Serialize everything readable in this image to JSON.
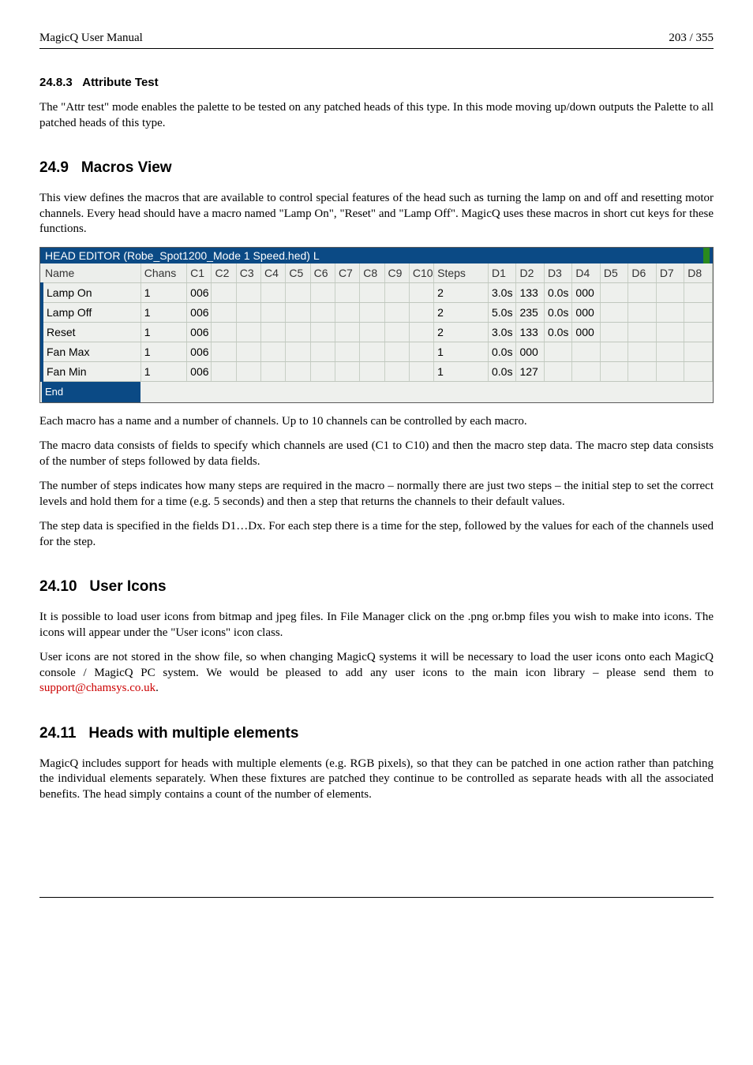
{
  "header": {
    "left": "MagicQ User Manual",
    "right": "203 / 355"
  },
  "sec1": {
    "num": "24.8.3",
    "title": "Attribute Test",
    "p1": "The \"Attr test\" mode enables the palette to be tested on any patched heads of this type. In this mode moving up/down outputs the Palette to all patched heads of this type."
  },
  "sec2": {
    "num": "24.9",
    "title": "Macros View",
    "p1": "This view defines the macros that are available to control special features of the head such as turning the lamp on and off and resetting motor channels. Every head should have a macro named \"Lamp On\", \"Reset\" and \"Lamp Off\". MagicQ uses these macros in short cut keys for these functions.",
    "p2": "Each macro has a name and a number of channels. Up to 10 channels can be controlled by each macro.",
    "p3": "The macro data consists of fields to specify which channels are used (C1 to C10) and then the macro step data. The macro step data consists of the number of steps followed by data fields.",
    "p4": "The number of steps indicates how many steps are required in the macro – normally there are just two steps – the initial step to set the correct levels and hold them for a time (e.g. 5 seconds) and then a step that returns the channels to their default values.",
    "p5": "The step data is specified in the fields D1…Dx. For each step there is a time for the step, followed by the values for each of the channels used for the step."
  },
  "grid": {
    "title": "HEAD EDITOR (Robe_Spot1200_Mode 1 Speed.hed) L",
    "cols": [
      "Name",
      "Chans",
      "C1",
      "C2",
      "C3",
      "C4",
      "C5",
      "C6",
      "C7",
      "C8",
      "C9",
      "C10",
      "Steps",
      "D1",
      "D2",
      "D3",
      "D4",
      "D5",
      "D6",
      "D7",
      "D8"
    ],
    "rows": [
      {
        "name": "Lamp On",
        "chans": "1",
        "c1": "006",
        "steps": "2",
        "d1": "3.0s",
        "d2": "133",
        "d3": "0.0s",
        "d4": "000"
      },
      {
        "name": "Lamp Off",
        "chans": "1",
        "c1": "006",
        "steps": "2",
        "d1": "5.0s",
        "d2": "235",
        "d3": "0.0s",
        "d4": "000"
      },
      {
        "name": "Reset",
        "chans": "1",
        "c1": "006",
        "steps": "2",
        "d1": "3.0s",
        "d2": "133",
        "d3": "0.0s",
        "d4": "000"
      },
      {
        "name": "Fan Max",
        "chans": "1",
        "c1": "006",
        "steps": "1",
        "d1": "0.0s",
        "d2": "000"
      },
      {
        "name": "Fan Min",
        "chans": "1",
        "c1": "006",
        "steps": "1",
        "d1": "0.0s",
        "d2": "127"
      }
    ],
    "end": "End"
  },
  "sec3": {
    "num": "24.10",
    "title": "User Icons",
    "p1": "It is possible to load user icons from bitmap and jpeg files. In File Manager click on the .png or.bmp files you wish to make into icons. The icons will appear under the \"User icons\" icon class.",
    "p2a": "User icons are not stored in the show file, so when changing MagicQ systems it will be necessary to load the user icons onto each MagicQ console / MagicQ PC system. We would be pleased to add any user icons to the main icon library – please send them to ",
    "p2link": "support@chamsys.co.uk",
    "p2b": "."
  },
  "sec4": {
    "num": "24.11",
    "title": "Heads with multiple elements",
    "p1": "MagicQ includes support for heads with multiple elements (e.g. RGB pixels), so that they can be patched in one action rather than patching the individual elements separately. When these fixtures are patched they continue to be controlled as separate heads with all the associated benefits. The head simply contains a count of the number of elements."
  }
}
